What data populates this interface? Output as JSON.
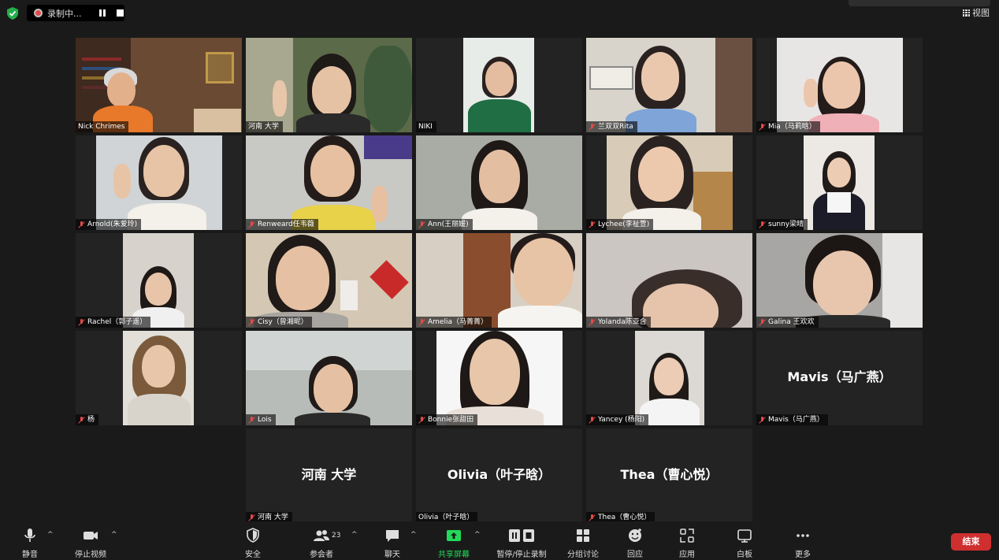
{
  "recording": {
    "label": "录制中..."
  },
  "view_button": {
    "label": "视图"
  },
  "participants": [
    {
      "name": "Nick Chrimes",
      "muted": false
    },
    {
      "name": "河南 大学",
      "muted": false
    },
    {
      "name": "NIKI",
      "muted": false
    },
    {
      "name": "兰双双Rita",
      "muted": true
    },
    {
      "name": "Mia（马莉晗）",
      "muted": true
    },
    {
      "name": "Arnold(朱爱玲)",
      "muted": true
    },
    {
      "name": "Renweard任韦薇",
      "muted": true
    },
    {
      "name": "Ann(王丽媛)",
      "muted": true
    },
    {
      "name": "Lychee(李祉萱)",
      "muted": true
    },
    {
      "name": "sunny梁晴",
      "muted": true
    },
    {
      "name": "Rachel（郭子遥）",
      "muted": true
    },
    {
      "name": "Cisy（曾湘昵）",
      "muted": true
    },
    {
      "name": "Amelia（马菁菁）",
      "muted": true
    },
    {
      "name": "Yolanda陈亚含",
      "muted": true
    },
    {
      "name": "Galina 王欢欢",
      "muted": true
    },
    {
      "name": "杨",
      "muted": true
    },
    {
      "name": "Lois",
      "muted": true
    },
    {
      "name": "Bonnie张甜田",
      "muted": true
    },
    {
      "name": "Yancey (杨阳)",
      "muted": true
    },
    {
      "name": "Mavis（马广燕）",
      "muted": true,
      "display": "Mavis（马广燕）"
    },
    {
      "name": "河南 大学",
      "muted": true,
      "display": "河南 大学"
    },
    {
      "name": "Olivia（叶子晗）",
      "muted": false,
      "display": "Olivia（叶子晗）"
    },
    {
      "name": "Thea（曹心悦）",
      "muted": true,
      "display": "Thea（曹心悦）"
    }
  ],
  "toolbar": {
    "mute": "静音",
    "stop_video": "停止视频",
    "security": "安全",
    "participants": "参会者",
    "participant_count": "23",
    "chat": "聊天",
    "share_screen": "共享屏幕",
    "pause_stop_recording": "暂停/停止录制",
    "breakout": "分组讨论",
    "reactions": "回应",
    "apps": "应用",
    "whiteboard": "白板",
    "more": "更多",
    "end": "结束"
  },
  "colors": {
    "background": "#1a1a1a",
    "tile": "#232323",
    "active_speaker": "#dfe27a",
    "share_green": "#23d959",
    "end_red": "#cf2f2f",
    "mute_red": "#e34a4a"
  }
}
